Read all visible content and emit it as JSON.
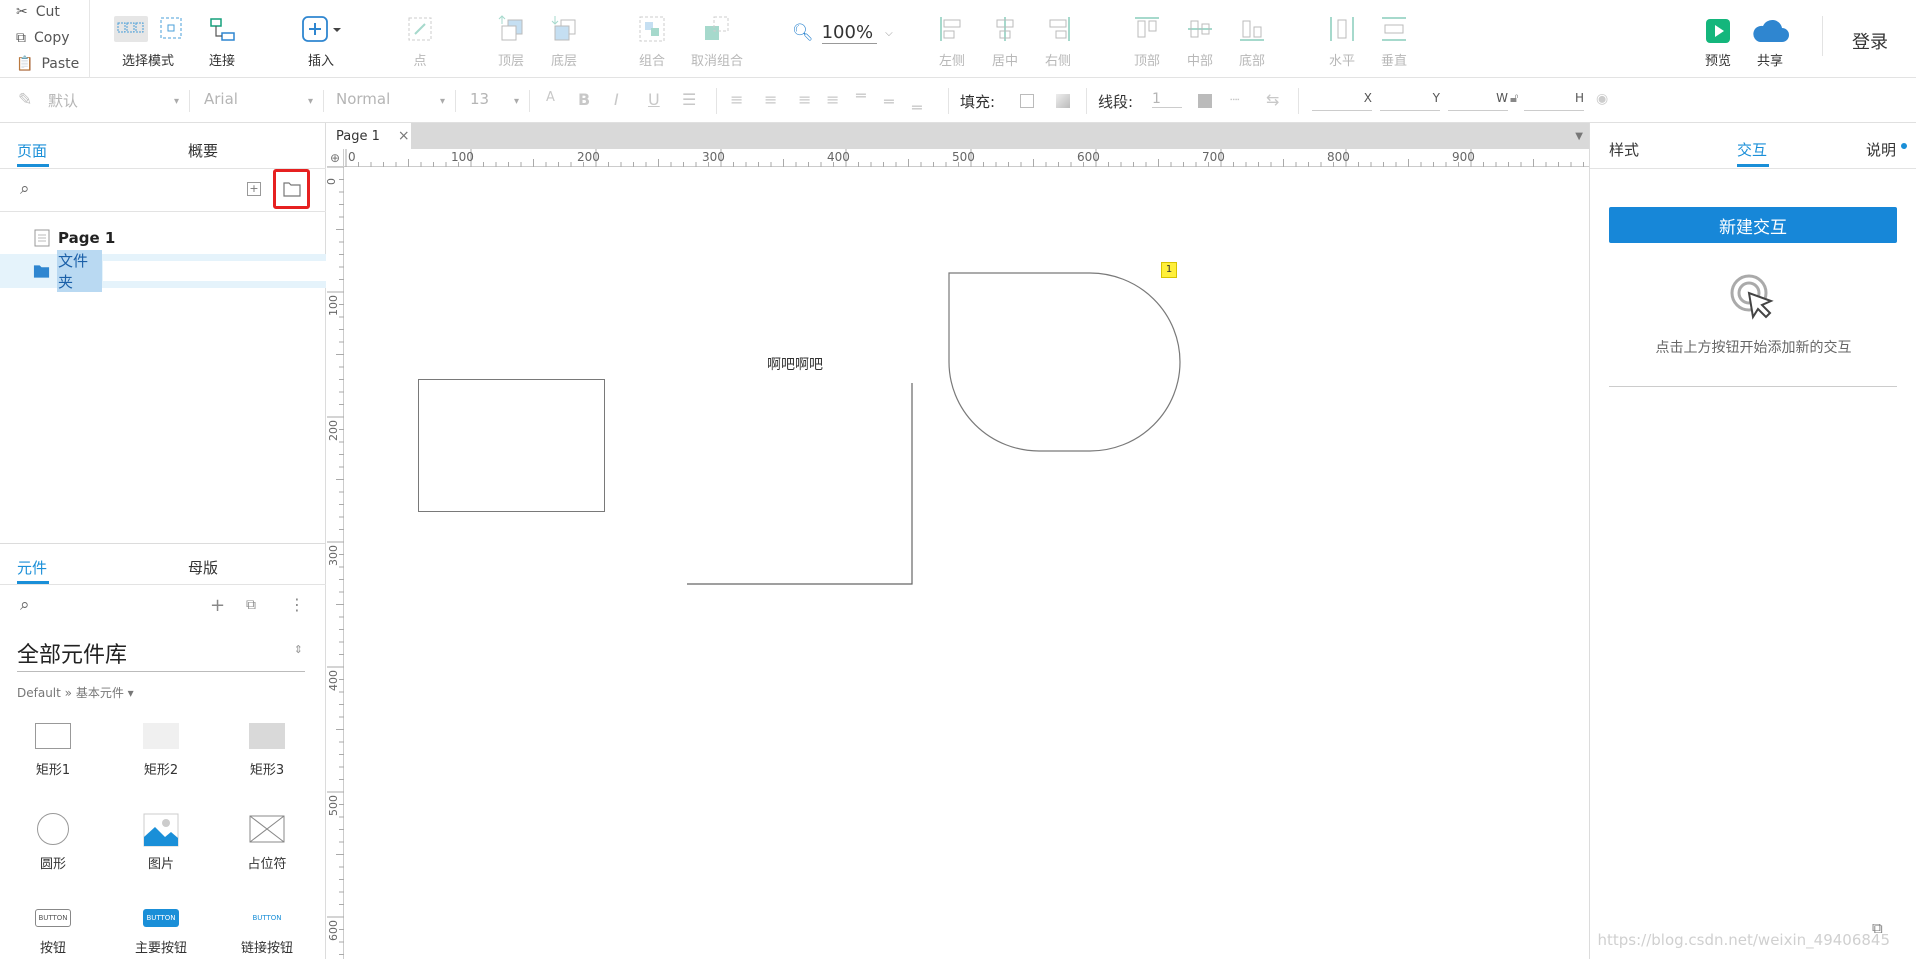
{
  "clipboard": {
    "cut": "Cut",
    "copy": "Copy",
    "paste": "Paste"
  },
  "toolbar": {
    "select_mode": "选择模式",
    "connect": "连接",
    "insert": "插入",
    "point": "点",
    "top_layer": "顶层",
    "bottom_layer": "底层",
    "group": "组合",
    "ungroup": "取消组合",
    "zoom": "100%",
    "align_left": "左侧",
    "align_center": "居中",
    "align_right": "右侧",
    "align_top": "顶部",
    "align_middle": "中部",
    "align_bottom": "底部",
    "distribute_h": "水平",
    "distribute_v": "垂直",
    "preview": "预览",
    "share": "共享",
    "login": "登录"
  },
  "format": {
    "style": "默认",
    "font": "Arial",
    "weight": "Normal",
    "size": "13",
    "fill_label": "填充:",
    "line_label": "线段:",
    "line_width": "1",
    "x_label": "X",
    "y_label": "Y",
    "w_label": "W",
    "h_label": "H"
  },
  "left": {
    "tab_pages": "页面",
    "tab_outline": "概要",
    "pages": [
      {
        "name": "Page 1",
        "type": "page"
      },
      {
        "name": "文件夹",
        "type": "folder",
        "selected": true
      }
    ],
    "tab_widgets": "元件",
    "tab_masters": "母版",
    "library_title": "全部元件库",
    "library_path": "Default » 基本元件 ▾",
    "widgets": [
      {
        "label": "矩形1"
      },
      {
        "label": "矩形2"
      },
      {
        "label": "矩形3"
      },
      {
        "label": "圆形"
      },
      {
        "label": "图片"
      },
      {
        "label": "占位符"
      },
      {
        "label": "按钮",
        "thumb": "BUTTON"
      },
      {
        "label": "主要按钮",
        "thumb": "BUTTON"
      },
      {
        "label": "链接按钮",
        "thumb": "BUTTON"
      }
    ]
  },
  "canvas": {
    "page_tab": "Page 1",
    "ruler_h": [
      "0",
      "100",
      "200",
      "300",
      "400",
      "500",
      "600",
      "700",
      "800",
      "900"
    ],
    "ruler_v": [
      "0",
      "100",
      "200",
      "300",
      "400",
      "500",
      "600"
    ],
    "text_label": "啊吧啊吧",
    "badge": "1"
  },
  "right": {
    "tab_style": "样式",
    "tab_interaction": "交互",
    "tab_notes": "说明",
    "new_interaction": "新建交互",
    "hint": "点击上方按钮开始添加新的交互"
  },
  "watermark": "https://blog.csdn.net/weixin_49406845",
  "colors": {
    "accent": "#1a8fd8",
    "button": "#1787d8",
    "highlight_box": "#e62020",
    "selected_row": "#e5f3fb",
    "preview_green": "#14b67c"
  }
}
